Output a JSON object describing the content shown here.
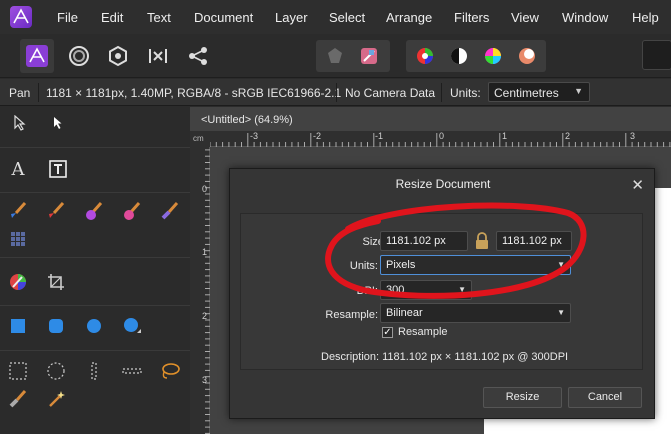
{
  "menubar": {
    "items": [
      "File",
      "Edit",
      "Text",
      "Document",
      "Layer",
      "Select",
      "Arrange",
      "Filters",
      "View",
      "Window",
      "Help"
    ]
  },
  "toolbar": {
    "personas": [
      "photo-persona-icon",
      "liquify-persona-icon",
      "develop-persona-icon",
      "tone-mapping-persona-icon",
      "export-persona-icon"
    ],
    "right_icons": [
      "color-wheel-icon",
      "contrast-icon",
      "hue-icon",
      "white-balance-icon"
    ]
  },
  "contextbar": {
    "tool": "Pan",
    "info": "1181 × 1181px, 1.40MP, RGBA/8 - sRGB IEC61966-2.1",
    "camera": "No Camera Data",
    "units_label": "Units:",
    "units_value": "Centimetres"
  },
  "document": {
    "tab_title": "<Untitled> (64.9%)",
    "ruler_unit": "cm",
    "top_ruler_ticks": [
      "-3",
      "-2",
      "-1",
      "0",
      "1",
      "2",
      "3"
    ],
    "left_ruler_ticks": [
      "0",
      "1",
      "2",
      "3"
    ]
  },
  "dialog": {
    "title": "Resize Document",
    "size_label": "Size:",
    "width_value": "1181.102 px",
    "height_value": "1181.102 px",
    "units_label": "Units:",
    "units_value": "Pixels",
    "dpi_label": "DPI:",
    "dpi_value": "300",
    "resample_label": "Resample:",
    "resample_value": "Bilinear",
    "resample_checkbox_label": "Resample",
    "resample_checked": true,
    "description": "Description: 1181.102 px × 1181.102 px @ 300DPI",
    "resize_button": "Resize",
    "cancel_button": "Cancel"
  },
  "annotation": {
    "color": "#e0141c"
  }
}
